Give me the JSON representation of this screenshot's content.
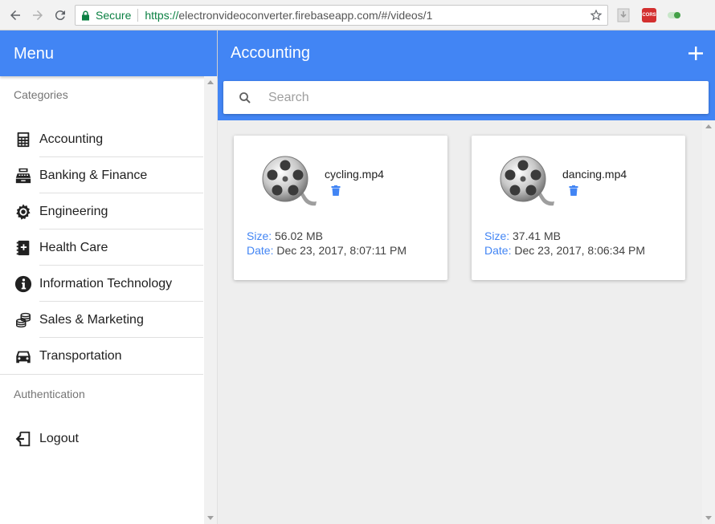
{
  "browser": {
    "secure_label": "Secure",
    "url_scheme": "https://",
    "url_rest": "electronvideoconverter.firebaseapp.com/#/videos/1",
    "extension_label": "CORS"
  },
  "sidebar": {
    "title": "Menu",
    "categories_header": "Categories",
    "items": [
      {
        "label": "Accounting",
        "icon": "calculator-icon"
      },
      {
        "label": "Banking & Finance",
        "icon": "cash-register-icon"
      },
      {
        "label": "Engineering",
        "icon": "gear-icon"
      },
      {
        "label": "Health Care",
        "icon": "medical-book-icon"
      },
      {
        "label": "Information Technology",
        "icon": "info-icon"
      },
      {
        "label": "Sales & Marketing",
        "icon": "coins-icon"
      },
      {
        "label": "Transportation",
        "icon": "car-icon"
      }
    ],
    "auth_header": "Authentication",
    "logout_label": "Logout"
  },
  "main": {
    "title": "Accounting",
    "search_placeholder": "Search",
    "size_key": "Size:",
    "date_key": "Date:",
    "videos": [
      {
        "name": "cycling.mp4",
        "size": "56.02 MB",
        "date": "Dec 23, 2017, 8:07:11 PM"
      },
      {
        "name": "dancing.mp4",
        "size": "37.41 MB",
        "date": "Dec 23, 2017, 8:06:34 PM"
      }
    ]
  },
  "colors": {
    "primary": "#4285f4",
    "secure_green": "#0b8043",
    "background": "#eeeeee"
  }
}
